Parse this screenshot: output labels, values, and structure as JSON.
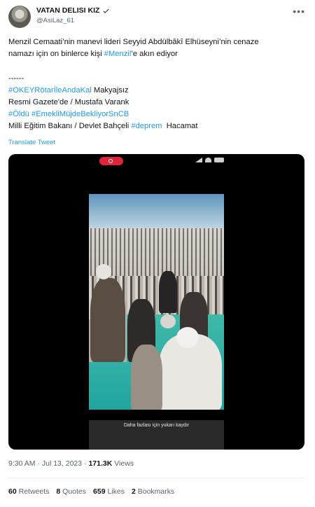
{
  "author": {
    "name": "VATAN DELISI KIZ",
    "handle": "@AsiLaz_61"
  },
  "tweet": {
    "line1": "Menzil Cemaati’nin manevi lideri Seyyid Abdülbâkî Elhüseyni’nin cenaze",
    "line2_a": "namazı için on binlerce kişi ",
    "line2_tag": "#Menzil",
    "line2_b": "’e akın ediyor",
    "separator": "------",
    "tag1": "#OKEYRötarİleAndaKal",
    "tag1_after": " Makyajsız",
    "line_resmi": "Resmi Gazete'de / Mustafa Varank",
    "tag2": "#Öldü",
    "tag3": "#EmekliMüjdeBekliyorSnCB",
    "line_milli_a": "Milli Eğitim Bakanı / Devlet Bahçeli ",
    "tag4": "#deprem",
    "line_milli_b": "  Hacamat"
  },
  "translate_label": "Translate Tweet",
  "video": {
    "caption": "Daha fazlası için yukarı kaydır"
  },
  "meta": {
    "time": "9:30 AM",
    "sep": " · ",
    "date": "Jul 13, 2023",
    "views_count": "171.3K",
    "views_label": " Views"
  },
  "stats": {
    "retweets_count": "60",
    "retweets_label": "Retweets",
    "quotes_count": "8",
    "quotes_label": "Quotes",
    "likes_count": "659",
    "likes_label": "Likes",
    "bookmarks_count": "2",
    "bookmarks_label": "Bookmarks"
  },
  "icons": [
    "verified-badge-icon",
    "more-options-icon",
    "record-indicator-icon",
    "signal-icon",
    "wifi-icon",
    "battery-icon"
  ],
  "colors": {
    "link": "#1d9bf0",
    "muted": "#536471",
    "text": "#0f1419",
    "record": "#e0243a"
  }
}
